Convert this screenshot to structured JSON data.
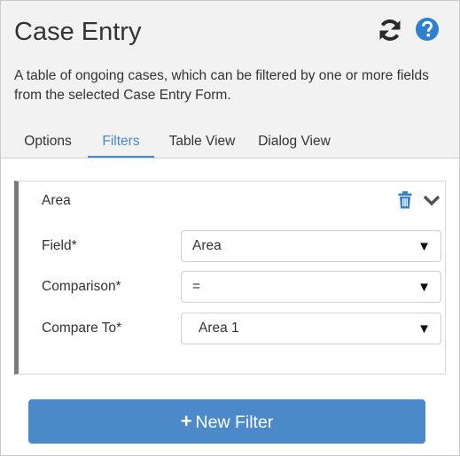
{
  "header": {
    "title": "Case Entry",
    "description": "A table of ongoing cases, which can be filtered by one or more fields from the selected Case Entry Form.",
    "icons": {
      "refresh": "refresh-icon",
      "help": "help-icon"
    }
  },
  "tabs": [
    {
      "label": "Options",
      "active": false
    },
    {
      "label": "Filters",
      "active": true
    },
    {
      "label": "Table View",
      "active": false
    },
    {
      "label": "Dialog View",
      "active": false
    }
  ],
  "filter": {
    "title": "Area",
    "icons": {
      "delete": "trash-icon",
      "collapse": "chevron-down-icon"
    },
    "fields": [
      {
        "label": "Field*",
        "value": "Area"
      },
      {
        "label": "Comparison*",
        "value": "="
      },
      {
        "label": "Compare To*",
        "value": "Area 1"
      }
    ]
  },
  "actions": {
    "new_filter_label": "New Filter",
    "new_filter_icon": "plus-icon"
  },
  "colors": {
    "accent": "#4a87c8",
    "button": "#4c89c9",
    "card_border": "#7a7a7a",
    "header_bg": "#f2f2f2"
  }
}
